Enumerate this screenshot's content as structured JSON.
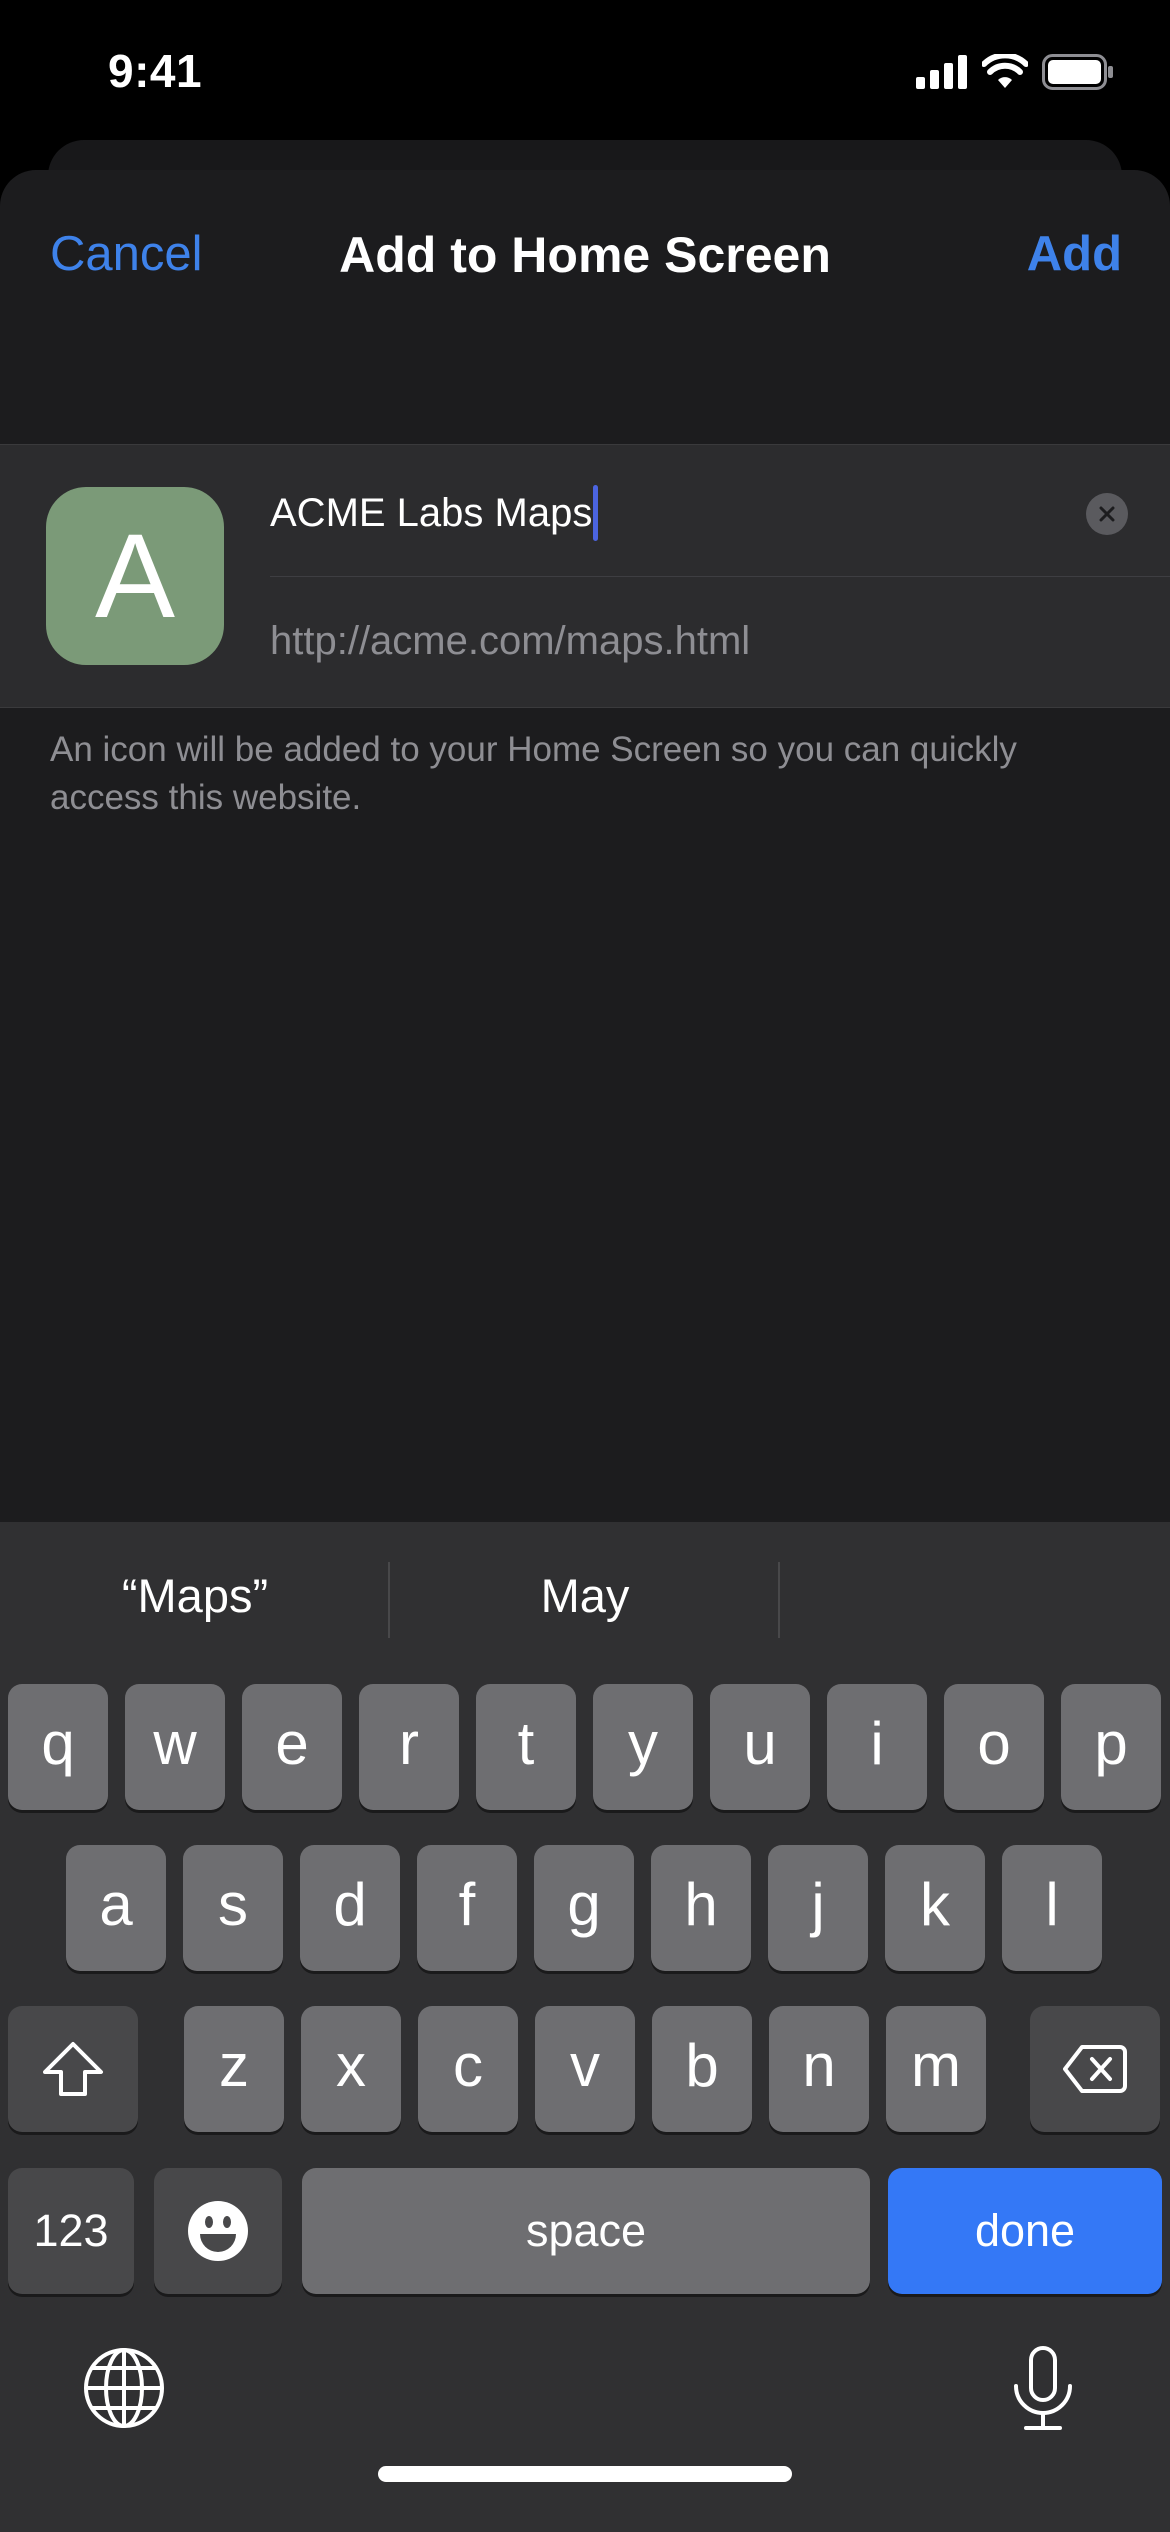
{
  "status_bar": {
    "time": "9:41",
    "icons": [
      "cellular-signal-icon",
      "wifi-icon",
      "battery-icon"
    ]
  },
  "nav": {
    "cancel_label": "Cancel",
    "title": "Add to Home Screen",
    "add_label": "Add"
  },
  "form": {
    "icon_letter": "A",
    "icon_color": "#7b9a78",
    "name_value": "ACME Labs Maps",
    "url_value": "http://acme.com/maps.html"
  },
  "footer_note": "An icon will be added to your Home Screen so you can quickly access this website.",
  "keyboard": {
    "suggestions": [
      "“Maps”",
      "May",
      ""
    ],
    "row1": [
      "q",
      "w",
      "e",
      "r",
      "t",
      "y",
      "u",
      "i",
      "o",
      "p"
    ],
    "row2": [
      "a",
      "s",
      "d",
      "f",
      "g",
      "h",
      "j",
      "k",
      "l"
    ],
    "row3": [
      "z",
      "x",
      "c",
      "v",
      "b",
      "n",
      "m"
    ],
    "numbers_label": "123",
    "space_label": "space",
    "done_label": "done",
    "accent_color": "#3478f6"
  },
  "colors": {
    "link_blue": "#3e82ea",
    "sheet_bg": "#1c1c1e",
    "group_bg": "#2c2c2e"
  }
}
